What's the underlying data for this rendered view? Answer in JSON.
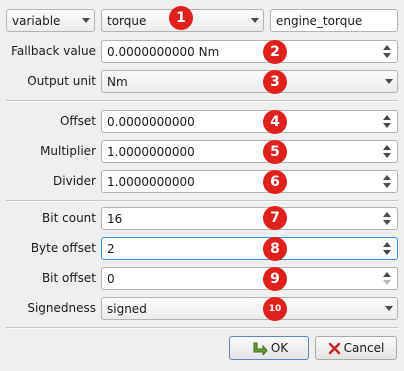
{
  "top": {
    "kind_value": "variable",
    "signal_value": "torque",
    "name_value": "engine_torque"
  },
  "fallback": {
    "label": "Fallback value",
    "value": "0.0000000000 Nm"
  },
  "output_unit": {
    "label": "Output unit",
    "value": "Nm"
  },
  "offset": {
    "label": "Offset",
    "value": "0.0000000000"
  },
  "multiplier": {
    "label": "Multiplier",
    "value": "1.0000000000"
  },
  "divider": {
    "label": "Divider",
    "value": "1.0000000000"
  },
  "bit_count": {
    "label": "Bit count",
    "value": "16"
  },
  "byte_offset": {
    "label": "Byte offset",
    "value": "2"
  },
  "bit_offset": {
    "label": "Bit offset",
    "value": "0"
  },
  "signedness": {
    "label": "Signedness",
    "value": "signed"
  },
  "badges": [
    "1",
    "2",
    "3",
    "4",
    "5",
    "6",
    "7",
    "8",
    "9",
    "10"
  ],
  "buttons": {
    "ok": "OK",
    "cancel": "Cancel"
  },
  "colors": {
    "badge": "#e0201b",
    "focus": "#3b8ed8"
  }
}
